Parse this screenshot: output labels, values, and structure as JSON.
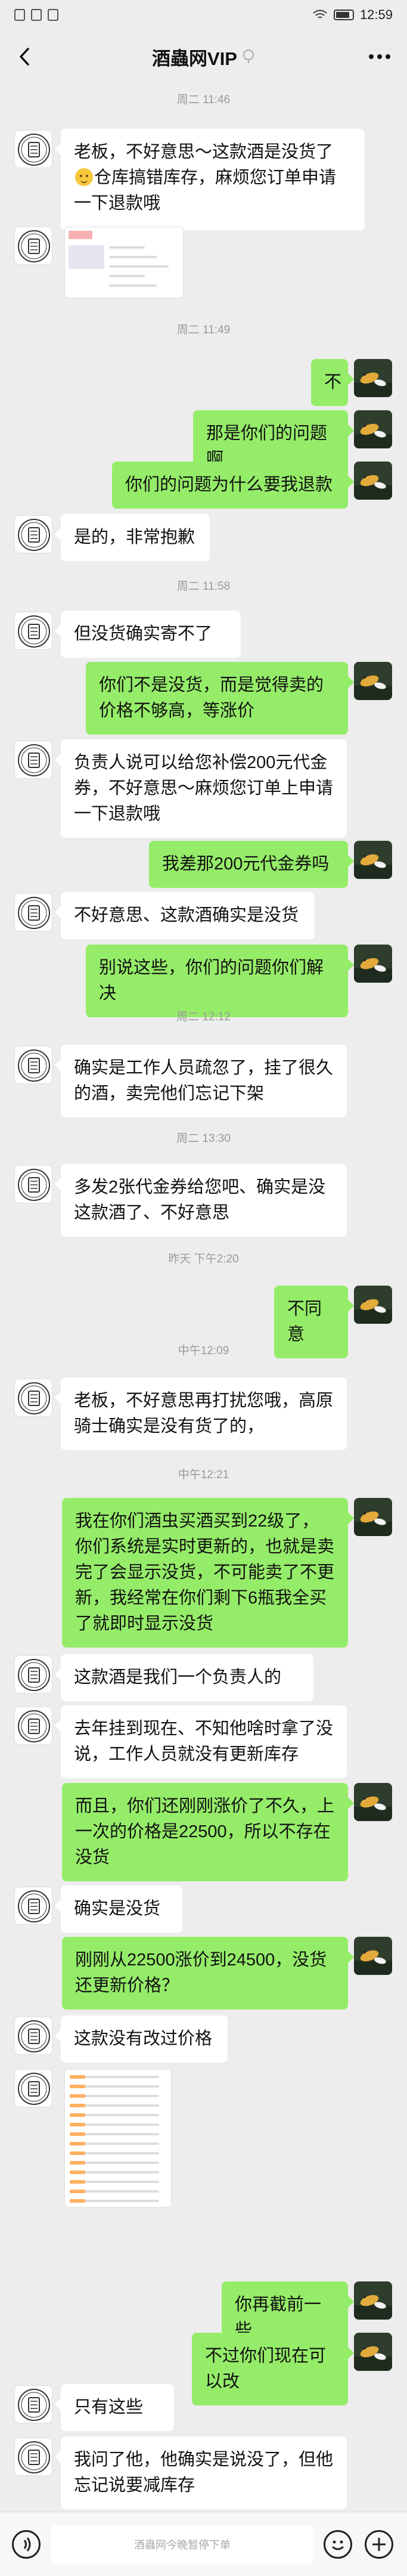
{
  "status_bar": {
    "time": "12:59"
  },
  "header": {
    "title": "酒蟲网VIP"
  },
  "timestamps": [
    "周二 11:46",
    "周二 11:49",
    "周二 11:58",
    "周二 12:12",
    "周二 13:30",
    "昨天 下午2:20",
    "中午12:09",
    "中午12:21"
  ],
  "messages": [
    {
      "side": "left",
      "text": "老板，不好意思～这款酒是没货了",
      "emoji": true,
      "text2": "仓库搞错库存，麻烦您订单申请一下退款哦"
    },
    {
      "side": "right",
      "text": "不"
    },
    {
      "side": "right",
      "text": "那是你们的问题啊"
    },
    {
      "side": "right",
      "text": "你们的问题为什么要我退款"
    },
    {
      "side": "left",
      "text": "是的，非常抱歉"
    },
    {
      "side": "left",
      "text": "但没货确实寄不了"
    },
    {
      "side": "right",
      "text": "你们不是没货，而是觉得卖的价格不够高，等涨价"
    },
    {
      "side": "left",
      "text": "负责人说可以给您补偿200元代金券，不好意思～麻烦您订单上申请一下退款哦"
    },
    {
      "side": "right",
      "text": "我差那200元代金券吗"
    },
    {
      "side": "left",
      "text": "不好意思、这款酒确实是没货"
    },
    {
      "side": "right",
      "text": "别说这些，你们的问题你们解决"
    },
    {
      "side": "left",
      "text": "确实是工作人员疏忽了，挂了很久的酒，卖完他们忘记下架"
    },
    {
      "side": "left",
      "text": "多发2张代金券给您吧、确实是没这款酒了、不好意思"
    },
    {
      "side": "right",
      "text": "不同意"
    },
    {
      "side": "left",
      "text": "老板，不好意思再打扰您哦，高原骑士确实是没有货了的，"
    },
    {
      "side": "right",
      "text": "我在你们酒虫买酒买到22级了，你们系统是实时更新的，也就是卖完了会显示没货，不可能卖了不更新，我经常在你们剩下6瓶我全买了就即时显示没货"
    },
    {
      "side": "left",
      "text": "这款酒是我们一个负责人的"
    },
    {
      "side": "left",
      "text": "去年挂到现在、不知他啥时拿了没说，工作人员就没有更新库存"
    },
    {
      "side": "right",
      "text": "而且，你们还刚刚涨价了不久，上一次的价格是22500，所以不存在没货"
    },
    {
      "side": "left",
      "text": "确实是没货"
    },
    {
      "side": "right",
      "text": "刚刚从22500涨价到24500，没货还更新价格？"
    },
    {
      "side": "left",
      "text": "这款没有改过价格"
    },
    {
      "side": "right",
      "text": "你再截前一些"
    },
    {
      "side": "right",
      "text": "不过你们现在可以改"
    },
    {
      "side": "left",
      "text": "只有这些"
    },
    {
      "side": "left",
      "text": "我问了他，他确实是说没了，但他忘记说要减库存"
    }
  ],
  "input": {
    "placeholder": "酒蟲网今晚暂停下单"
  }
}
